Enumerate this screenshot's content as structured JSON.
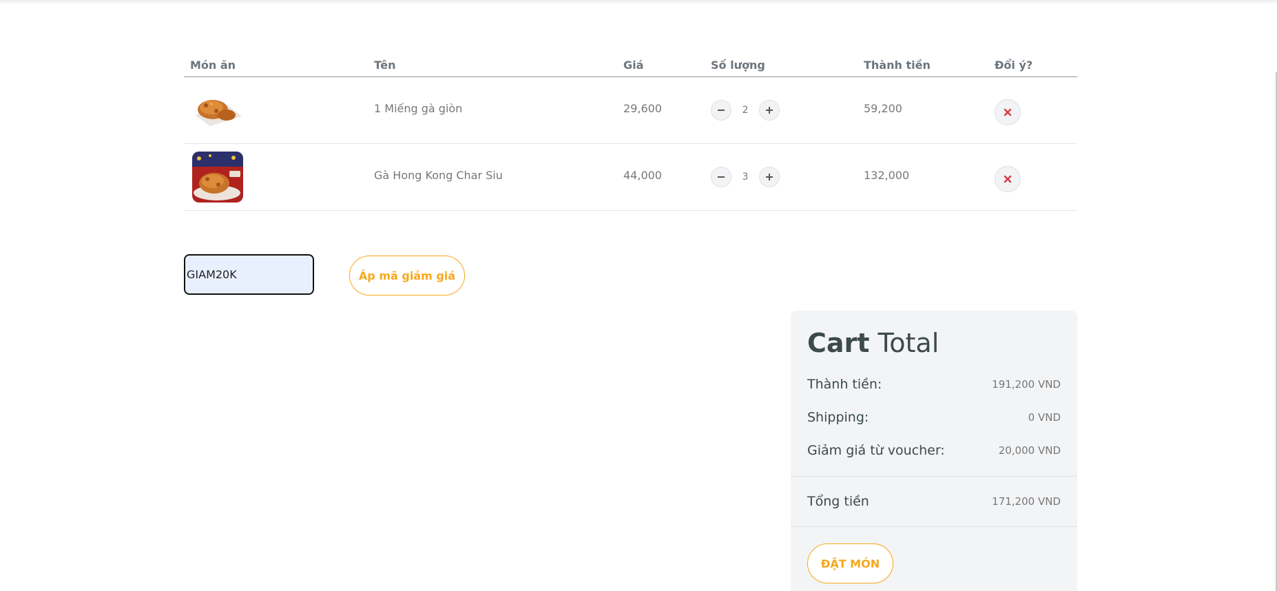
{
  "table": {
    "headers": {
      "image": "Món ăn",
      "name": "Tên",
      "price": "Giá",
      "quantity": "Số lượng",
      "subtotal": "Thành tiền",
      "remove": "Đổi ý?"
    },
    "rows": [
      {
        "name": "1 Miếng gà giòn",
        "price": "29,600",
        "quantity": "2",
        "subtotal": "59,200"
      },
      {
        "name": "Gà Hong Kong Char Siu",
        "price": "44,000",
        "quantity": "3",
        "subtotal": "132,000"
      }
    ]
  },
  "coupon": {
    "value": "GIAM20K",
    "apply_label": "Áp mã giảm giá"
  },
  "summary": {
    "title_bold": "Cart",
    "title_light": "Total",
    "subtotal_label": "Thành tiền:",
    "subtotal_value": "191,200 VND",
    "shipping_label": "Shipping:",
    "shipping_value": "0 VND",
    "discount_label": "Giảm giá từ voucher:",
    "discount_value": "20,000 VND",
    "total_label": "Tổng tiền",
    "total_value": "171,200 VND",
    "order_label": "ĐẶT MÓN"
  },
  "colors": {
    "accent": "#f7a81b",
    "remove_icon": "#dc3545",
    "summary_bg": "#f3f4f6",
    "heading": "#3c4a4a"
  },
  "icons": {
    "minus": "minus-icon",
    "plus": "plus-icon",
    "remove": "close-icon"
  }
}
